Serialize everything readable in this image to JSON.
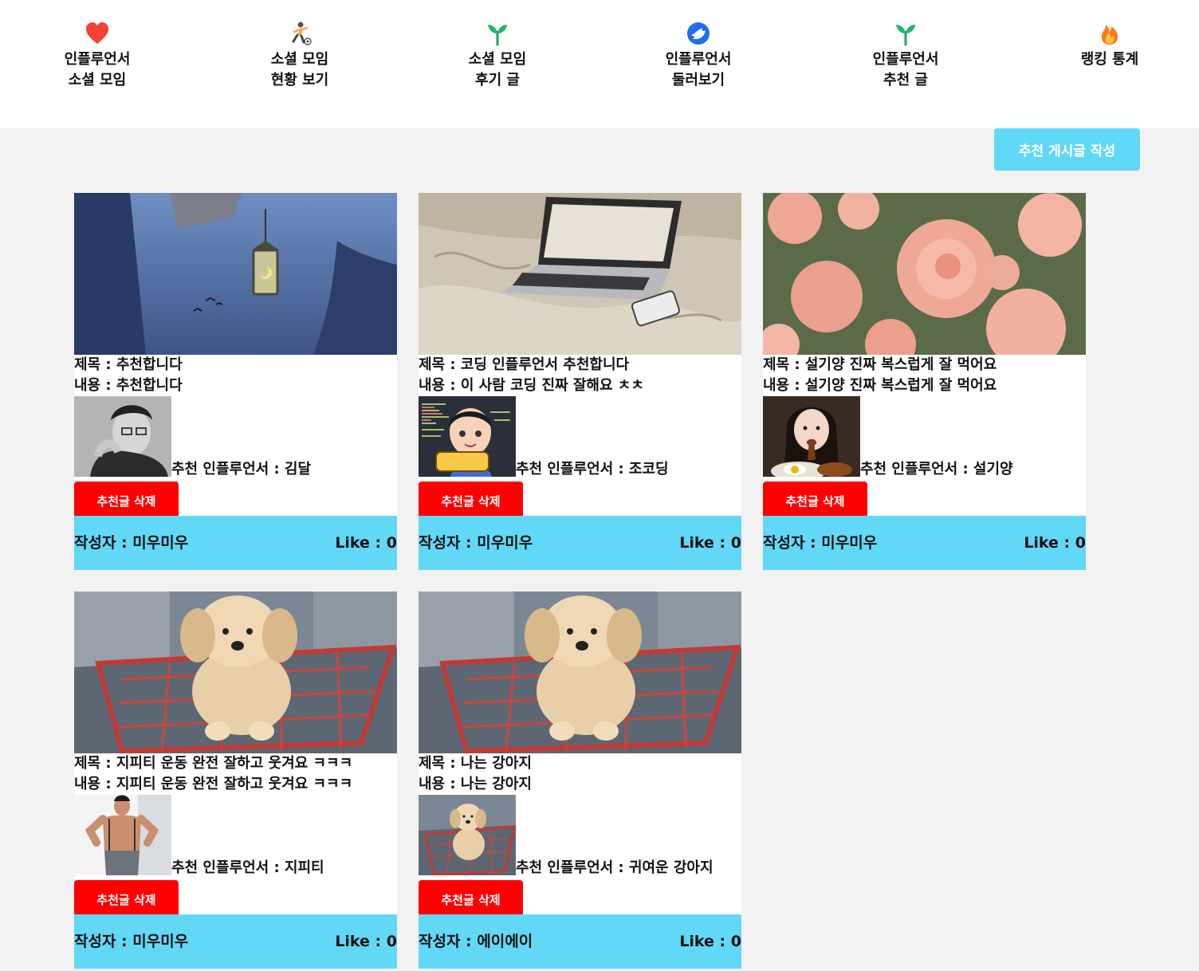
{
  "nav": {
    "items": [
      {
        "line1": "인플루언서",
        "line2": "소셜 모임",
        "icon": "heart-icon"
      },
      {
        "line1": "소셜 모임",
        "line2": "현황 보기",
        "icon": "soccer-player-icon"
      },
      {
        "line1": "소셜 모임",
        "line2": "후기 글",
        "icon": "seedling-icon"
      },
      {
        "line1": "인플루언서",
        "line2": "둘러보기",
        "icon": "blue-bird-badge-icon"
      },
      {
        "line1": "인플루언서",
        "line2": "추천 글",
        "icon": "seedling-icon"
      },
      {
        "line1": "랭킹 통계",
        "line2": "",
        "icon": "fire-icon"
      }
    ]
  },
  "write_button": "추천 게시글 작성",
  "cards": [
    {
      "title": "제목 : 추천합니다",
      "content": "내용 : 추천합니다",
      "influencer": "추천 인플루언서 : 김달",
      "delete_label": "추천글 삭제",
      "author": "작성자 : 미우미우",
      "likes": "Like : 0",
      "image": "night-lantern-photo",
      "thumb": "man-portrait-photo"
    },
    {
      "title": "제목 : 코딩 인플루언서 추천합니다",
      "content": "내용 : 이 사람 코딩 진짜 잘해요 ㅊㅊ",
      "influencer": "추천 인플루언서 : 조코딩",
      "delete_label": "추천글 삭제",
      "author": "작성자 : 미우미우",
      "likes": "Like : 0",
      "image": "laptop-on-bed-photo",
      "thumb": "jocoding-cartoon-logo"
    },
    {
      "title": "제목 : 설기양 진짜 복스럽게 잘 먹어요",
      "content": "내용 : 설기양 진짜 복스럽게 잘 먹어요",
      "influencer": "추천 인플루언서 : 설기양",
      "delete_label": "추천글 삭제",
      "author": "작성자 : 미우미우",
      "likes": "Like : 0",
      "image": "pink-roses-photo",
      "thumb": "girl-eating-photo"
    },
    {
      "title": "제목 : 지피티 운동 완전 잘하고 웃겨요 ㅋㅋㅋ",
      "content": "내용 : 지피티 운동 완전 잘하고 웃겨요 ㅋㅋㅋ",
      "influencer": "추천 인플루언서 : 지피티",
      "delete_label": "추천글 삭제",
      "author": "작성자 : 미우미우",
      "likes": "Like : 0",
      "image": "puppy-in-cart-photo",
      "thumb": "fitness-man-photo"
    },
    {
      "title": "제목 : 나는 강아지",
      "content": "내용 : 나는 강아지",
      "influencer": "추천 인플루언서 : 귀여운 강아지",
      "delete_label": "추천글 삭제",
      "author": "작성자 : 에이에이",
      "likes": "Like : 0",
      "image": "puppy-in-cart-photo",
      "thumb": "puppy-in-cart-photo"
    }
  ],
  "colors": {
    "accent": "#62d8f7",
    "delete": "#ff0000",
    "background": "#f2f2f2"
  }
}
